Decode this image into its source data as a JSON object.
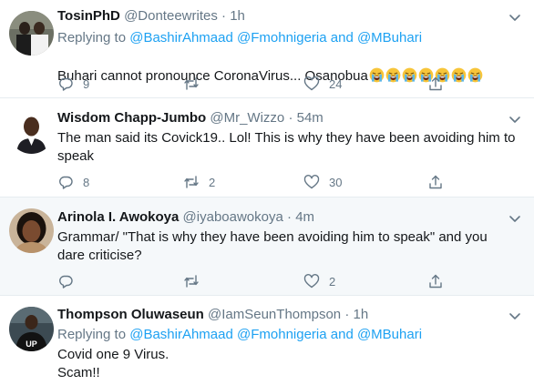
{
  "tweets": [
    {
      "name": "TosinPhD",
      "handle": "@Donteewrites",
      "sep": "·",
      "time": "1h",
      "replying_prefix": "Replying to",
      "replying_users": "@BashirAhmaad @Fmohnigeria and @MBuhari",
      "text": "Buhari cannot pronounce CoronaVirus... Osanobua",
      "emoji_count": 7,
      "emoji_name": "loudly-crying-face",
      "replies": "9",
      "retweets": "",
      "likes": "24"
    },
    {
      "name": "Wisdom Chapp-Jumbo",
      "handle": "@Mr_Wizzo",
      "sep": "·",
      "time": "54m",
      "text": "The man said its Covick19.. Lol! This is why they have been avoiding him to speak",
      "replies": "8",
      "retweets": "2",
      "likes": "30"
    },
    {
      "name": "Arinola I. Awokoya",
      "handle": "@iyaboawokoya",
      "sep": "·",
      "time": "4m",
      "text": "Grammar/ \"That is why they have been avoiding him to speak\" and you dare criticise?",
      "replies": "",
      "retweets": "",
      "likes": "2"
    },
    {
      "name": "Thompson Oluwaseun",
      "handle": "@IamSeunThompson",
      "sep": "·",
      "time": "1h",
      "replying_prefix": "Replying to",
      "replying_users": "@BashirAhmaad @Fmohnigeria and @MBuhari",
      "text": "Covid one 9 Virus.\nScam!!",
      "avatar_text": "UP"
    }
  ],
  "colors": {
    "link": "#1da1f2",
    "muted": "#657786",
    "text": "#14171a",
    "highlight_bg": "#f5f8fa",
    "divider": "#e6ecf0"
  }
}
